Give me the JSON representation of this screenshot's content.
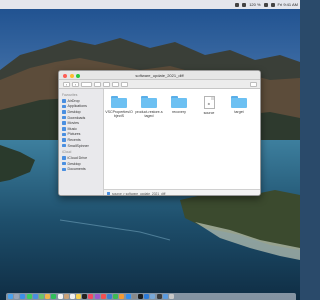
{
  "menubar": {
    "clock": "Fri 9:41 AM",
    "status_text": "120 %",
    "icons": [
      "wifi-icon",
      "battery-icon",
      "search-icon",
      "control-center-icon"
    ]
  },
  "window": {
    "title": "software_update_2021_diff",
    "toolbar": {
      "back_label": "‹",
      "forward_label": "›"
    },
    "sidebar": {
      "favorites_heading": "Favourites",
      "favorites": [
        "AirDrop",
        "Applications",
        "Desktop",
        "Downloads",
        "Movies",
        "Music",
        "Pictures",
        "Recents",
        "SmallSpinner"
      ],
      "locations_heading": "iCloud",
      "locations": [
        "iCloud Drive",
        "Desktop",
        "Documents"
      ]
    },
    "files": [
      {
        "name": "VSCProperties/ObjectS",
        "kind": "folder"
      },
      {
        "name": "product-restore-staged",
        "kind": "folder"
      },
      {
        "name": "recovery",
        "kind": "folder"
      },
      {
        "name": "source",
        "kind": "document"
      },
      {
        "name": "target",
        "kind": "folder"
      }
    ],
    "pathbar": "source > software_update_2021_diff"
  },
  "colors": {
    "folder": "#6cc0f2",
    "close": "#fe5f57",
    "minimize": "#febc2e",
    "zoom": "#28c840"
  },
  "dock": {
    "apps": [
      {
        "name": "finder",
        "color": "#4aa3f0"
      },
      {
        "name": "launchpad",
        "color": "#9aa6b8"
      },
      {
        "name": "safari",
        "color": "#3d8fe8"
      },
      {
        "name": "messages",
        "color": "#3ccf5b"
      },
      {
        "name": "mail",
        "color": "#4a90e2"
      },
      {
        "name": "maps",
        "color": "#6bc36b"
      },
      {
        "name": "photos",
        "color": "#f2b34a"
      },
      {
        "name": "facetime",
        "color": "#2fbf5b"
      },
      {
        "name": "calendar",
        "color": "#f4f4f4"
      },
      {
        "name": "contacts",
        "color": "#c9a27a"
      },
      {
        "name": "reminders",
        "color": "#f0f0f0"
      },
      {
        "name": "notes",
        "color": "#f6d04d"
      },
      {
        "name": "tv",
        "color": "#222222"
      },
      {
        "name": "music",
        "color": "#f44a62"
      },
      {
        "name": "podcasts",
        "color": "#9b59d0"
      },
      {
        "name": "news",
        "color": "#f25050"
      },
      {
        "name": "keynote",
        "color": "#3a7fd0"
      },
      {
        "name": "numbers",
        "color": "#3cba54"
      },
      {
        "name": "pages",
        "color": "#f29a33"
      },
      {
        "name": "app-store",
        "color": "#2f8ef0"
      },
      {
        "name": "settings",
        "color": "#8a8a8a"
      },
      {
        "name": "terminal",
        "color": "#1e1e1e"
      },
      {
        "name": "xcode",
        "color": "#2d7bd8"
      },
      {
        "name": "preview",
        "color": "#78a8d8"
      },
      {
        "name": "activity-monitor",
        "color": "#3c3c3c"
      },
      {
        "name": "downloads-stack",
        "color": "#5a9be0"
      },
      {
        "name": "trash",
        "color": "#c8c8c8"
      }
    ]
  }
}
